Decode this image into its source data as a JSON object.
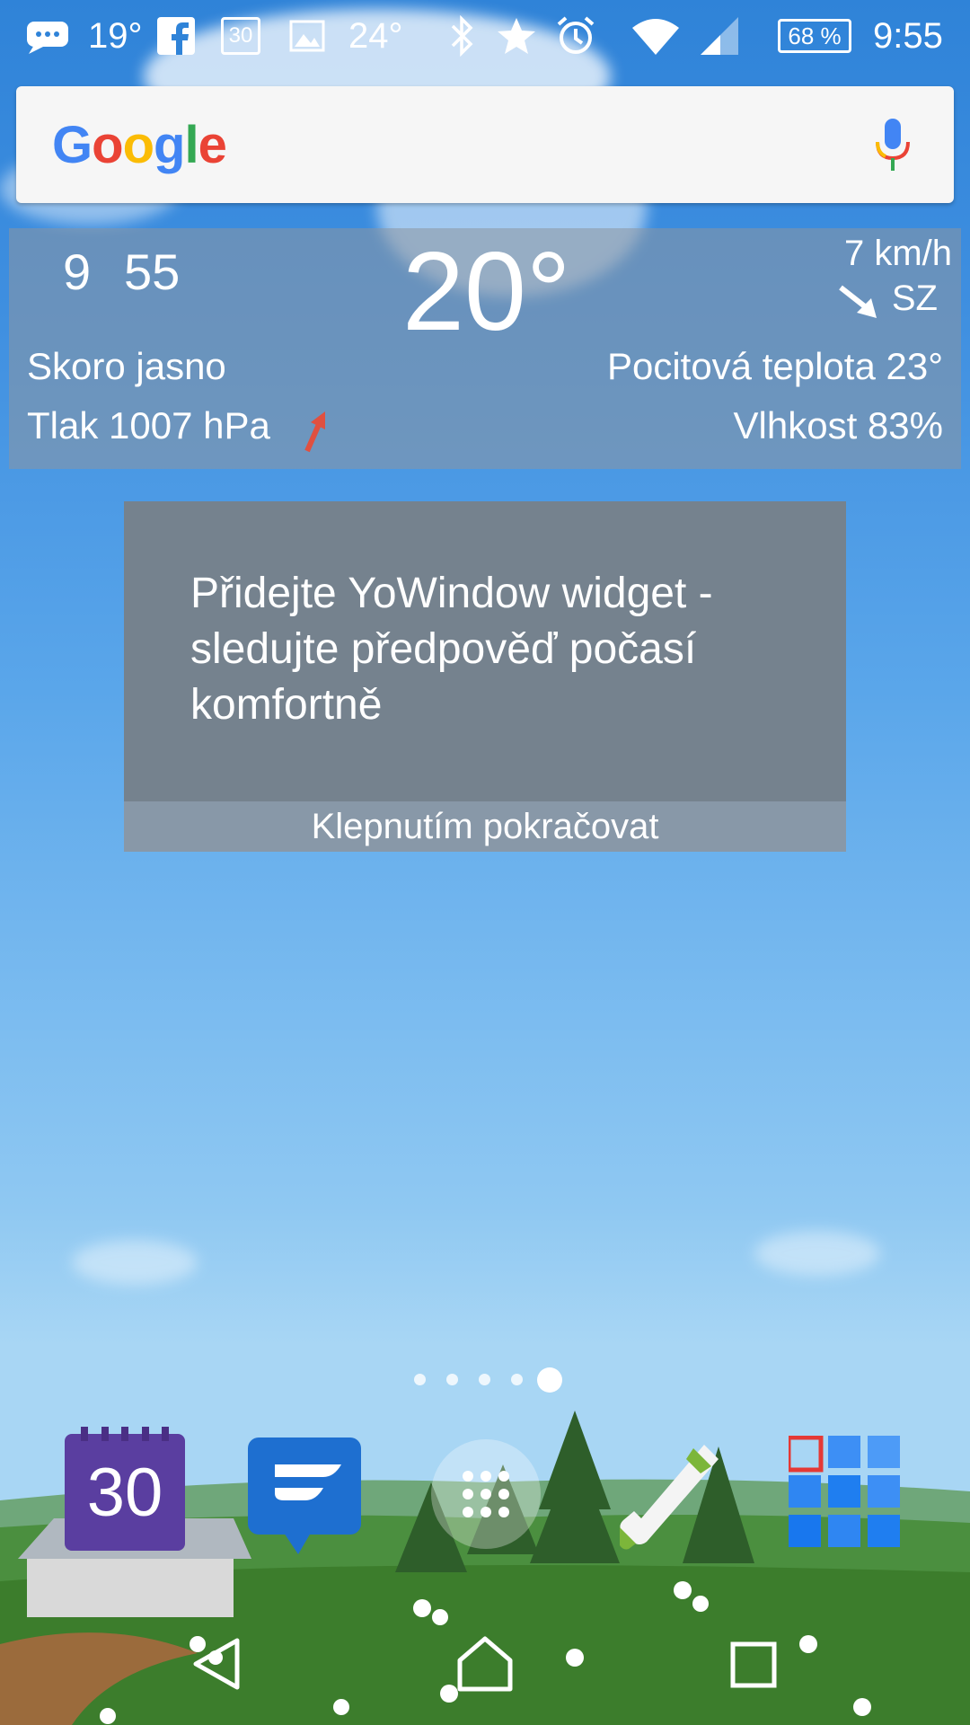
{
  "status_bar": {
    "temp_left": "19°",
    "calendar_day": "30",
    "temp_right": "24°",
    "battery": "68 %",
    "time": "9:55",
    "icons": [
      "chat-icon",
      "facebook-icon",
      "calendar-icon",
      "image-icon",
      "bluetooth-icon",
      "star-icon",
      "alarm-icon",
      "wifi-icon",
      "signal-icon",
      "battery-icon"
    ]
  },
  "search": {
    "logo": "Google"
  },
  "weather": {
    "hour": "9",
    "minute": "55",
    "temperature": "20°",
    "condition": "Skoro jasno",
    "pressure": "Tlak 1007 hPa",
    "wind_speed": "7 km/h",
    "wind_dir": "SZ",
    "feels_like": "Pocitová teplota 23°",
    "humidity": "Vlhkost 83%"
  },
  "promo": {
    "message": "Přidejte YoWindow widget - sledujte předpověď počasí komfortně",
    "action": "Klepnutím pokračovat"
  },
  "pages": {
    "count": 5,
    "active": 5
  },
  "dock": {
    "calendar_day": "30",
    "apps": [
      "calendar-app",
      "messaging-app",
      "app-drawer",
      "phone-app",
      "album-app"
    ]
  },
  "colors": {
    "sky_top": "#2f83d8",
    "calendar": "#5a3ea0",
    "messaging": "#1e6fd0",
    "promo_box": "#75828e"
  }
}
